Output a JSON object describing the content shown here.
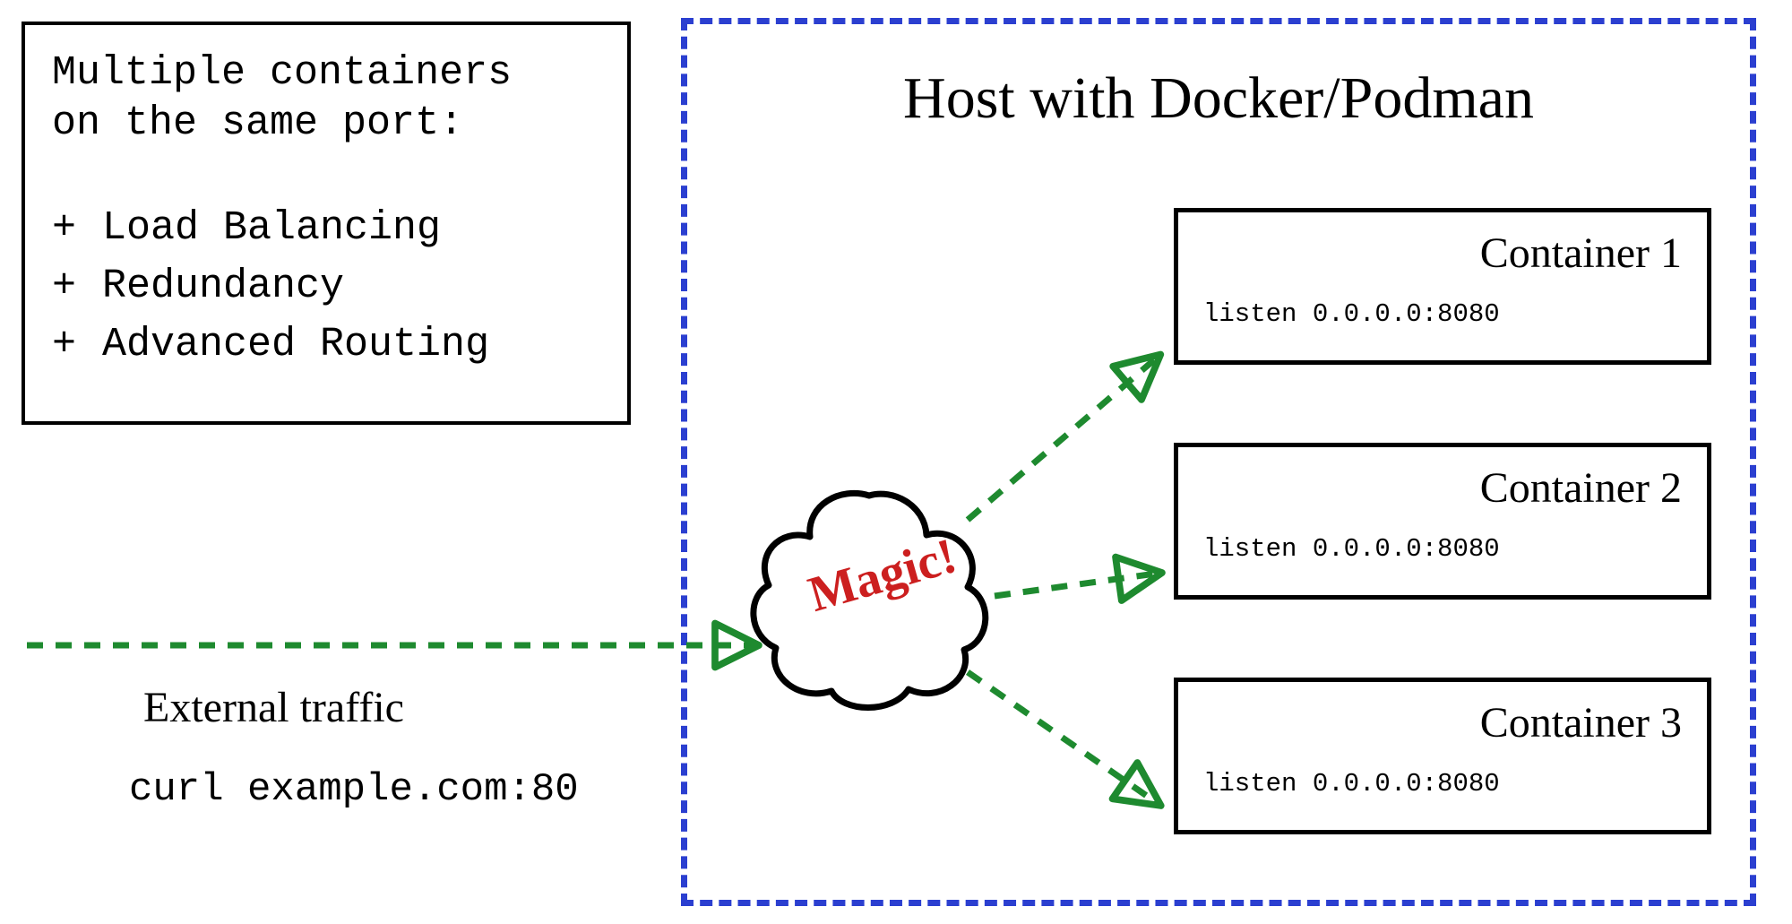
{
  "info": {
    "title": "Multiple containers\non the same port:",
    "bullets": [
      "Load Balancing",
      "Redundancy",
      "Advanced Routing"
    ],
    "bullet_prefix": "+"
  },
  "host": {
    "title": "Host with Docker/Podman"
  },
  "cloud": {
    "label": "Magic!"
  },
  "containers": [
    {
      "title": "Container 1",
      "listen": "listen 0.0.0.0:8080"
    },
    {
      "title": "Container 2",
      "listen": "listen 0.0.0.0:8080"
    },
    {
      "title": "Container 3",
      "listen": "listen 0.0.0.0:8080"
    }
  ],
  "external": {
    "label": "External traffic",
    "command": "curl example.com:80"
  },
  "colors": {
    "host_border": "#2b3fd0",
    "arrow": "#1e8a2f",
    "magic": "#cc1f1f",
    "ink": "#000000"
  }
}
